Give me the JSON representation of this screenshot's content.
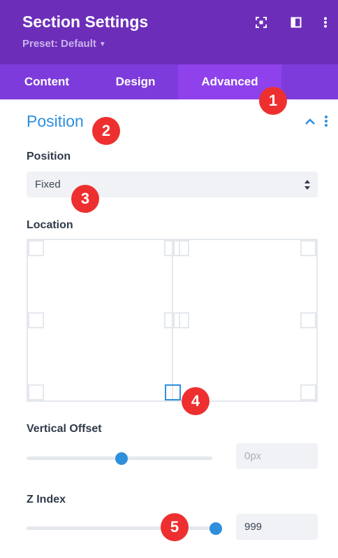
{
  "header": {
    "title": "Section Settings",
    "preset": "Preset: Default",
    "icons": [
      "focus-icon",
      "sidebar-layout-icon",
      "more-vertical-icon"
    ]
  },
  "tabs": [
    {
      "label": "Content",
      "active": false
    },
    {
      "label": "Design",
      "active": false
    },
    {
      "label": "Advanced",
      "active": true
    }
  ],
  "section": {
    "title": "Position",
    "icons": [
      "chevron-up-icon",
      "more-vertical-icon"
    ]
  },
  "position_field": {
    "label": "Position",
    "value": "Fixed"
  },
  "location_field": {
    "label": "Location",
    "selected": "bottom-center"
  },
  "vertical_offset": {
    "label": "Vertical Offset",
    "value": "0px",
    "slider_fraction": 0.5
  },
  "z_index": {
    "label": "Z Index",
    "value": "999",
    "slider_fraction": 1.0
  },
  "badges": [
    "1",
    "2",
    "3",
    "4",
    "5"
  ],
  "colors": {
    "header_bg": "#6c2eb9",
    "tabs_bg": "#7d3bdb",
    "active_tab_bg": "#8f42ec",
    "accent_blue": "#2e8fdd",
    "badge_red": "#ee2f2f"
  }
}
